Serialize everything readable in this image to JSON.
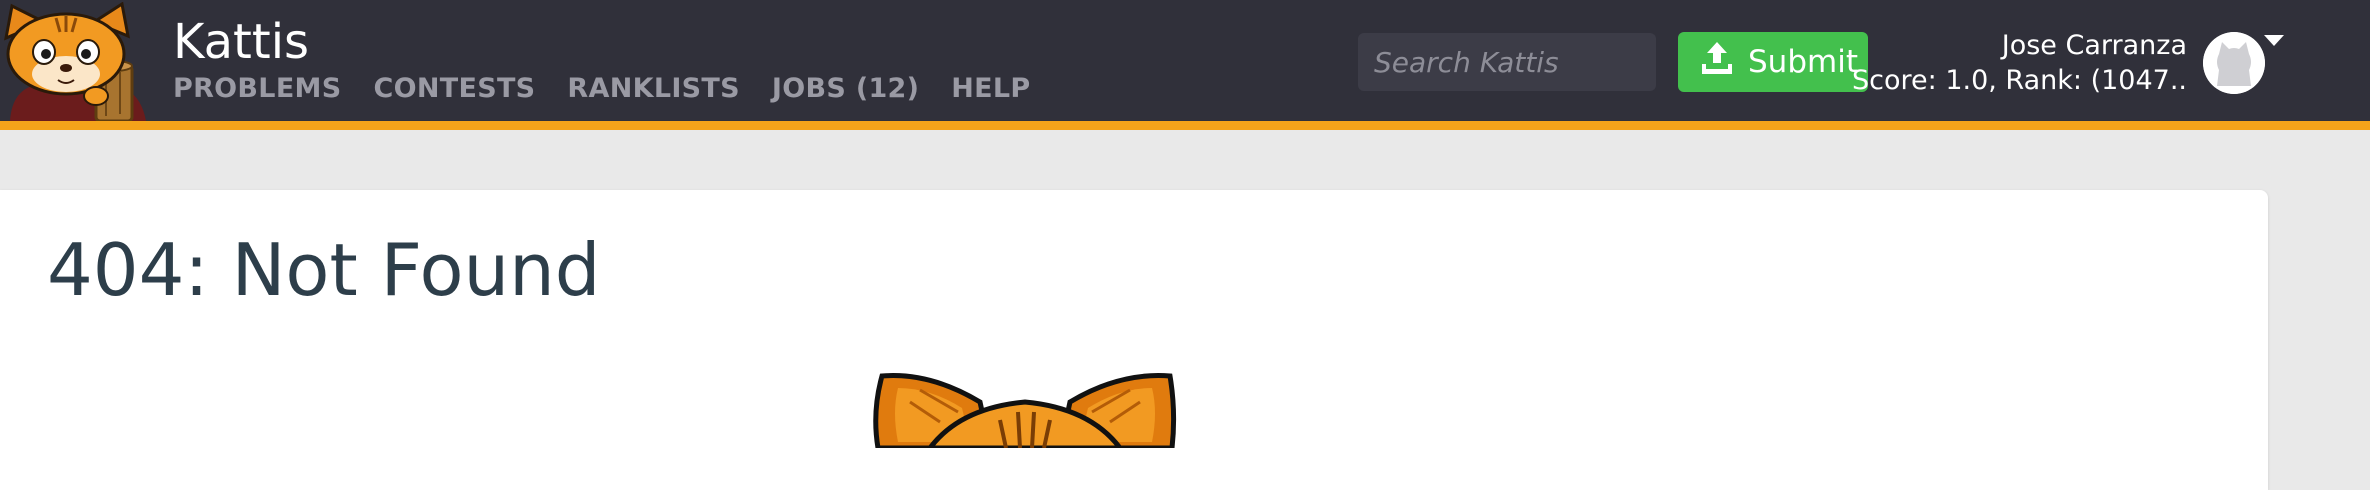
{
  "header": {
    "brand": "Kattis",
    "nav": [
      {
        "label": "PROBLEMS"
      },
      {
        "label": "CONTESTS"
      },
      {
        "label": "RANKLISTS"
      },
      {
        "label": "JOBS (12)"
      },
      {
        "label": "HELP"
      }
    ],
    "search": {
      "placeholder": "Search Kattis",
      "value": ""
    },
    "submit_label": "Submit",
    "user": {
      "name": "Jose Carranza",
      "stats": "Score: 1.0, Rank: (1047.."
    }
  },
  "main": {
    "title": "404: Not Found"
  },
  "icons": [
    "kattis-logo-icon",
    "search-icon",
    "upload-icon",
    "avatar-icon",
    "chevron-down-icon",
    "cat-illustration"
  ],
  "colors": {
    "navbar": "#30303a",
    "accent": "#f5a31a",
    "submit": "#43c04d",
    "nav_text": "#9a9aa4",
    "title_text": "#2d3e4a"
  }
}
